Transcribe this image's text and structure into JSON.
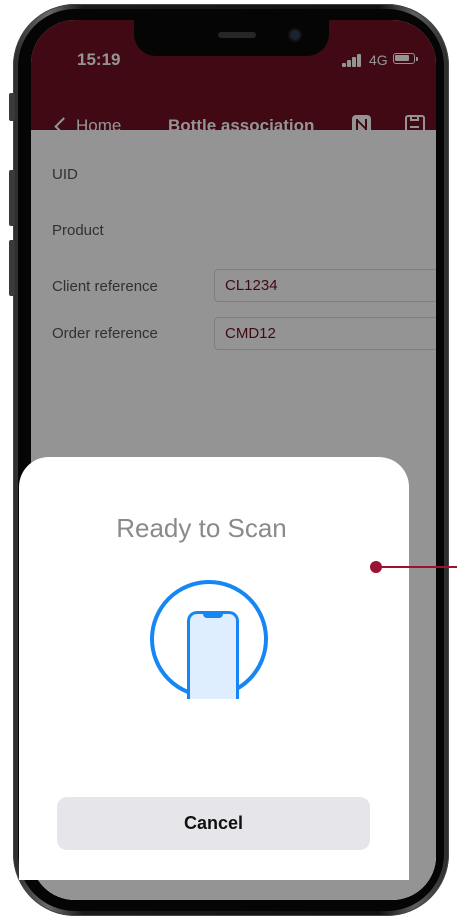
{
  "status_bar": {
    "time": "15:19",
    "network": "4G"
  },
  "nav": {
    "back_label": "Home",
    "title": "Bottle association",
    "nfc_icon": "nfc-icon",
    "save_icon": "save-icon"
  },
  "form": {
    "fields": [
      {
        "label": "UID",
        "value": ""
      },
      {
        "label": "Product",
        "value": ""
      },
      {
        "label": "Client reference",
        "value": "CL1234"
      },
      {
        "label": "Order reference",
        "value": "CMD12"
      }
    ]
  },
  "scan_sheet": {
    "title": "Ready to Scan",
    "icon": "phone-scan-icon",
    "cancel_label": "Cancel"
  },
  "colors": {
    "header": "#701023",
    "accent_blue": "#1786f5",
    "callout": "#9b1330"
  }
}
